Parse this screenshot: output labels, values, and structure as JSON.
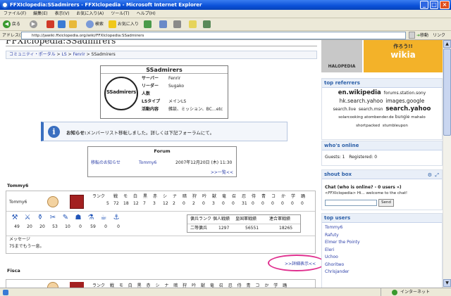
{
  "window": {
    "title": "FFXIclopedia:SSadmirers - FFXIclopedia - Microsoft Internet Explorer"
  },
  "menu": [
    "ファイル(F)",
    "編集(E)",
    "表示(V)",
    "お気に入り(A)",
    "ツール(T)",
    "ヘルプ(H)"
  ],
  "toolbar": {
    "back": "戻る",
    "search": "検索",
    "favorites": "お気に入り"
  },
  "address": {
    "label": "アドレス(D)",
    "url": "http://jawiki.ffxiclopedia.org/wiki/FFXIclopedia:SSadmirers",
    "go": "移動",
    "links": "リンク"
  },
  "page": {
    "title": "FFXIclopedia:SSadmirers",
    "breadcrumb": {
      "a": "コミュニティ・ポータル",
      "b": "LS",
      "c": "Fenrir",
      "d": "SSadmirers"
    },
    "infobox": {
      "name": "SSadmirers",
      "logo_text": "SSadmirers",
      "rows": [
        [
          "サーバー",
          "Fenrir"
        ],
        [
          "リーダー",
          "Sugako"
        ],
        [
          "人数",
          ""
        ],
        [
          "LSタイプ",
          "メインLS"
        ],
        [
          "活動内容",
          "雑談、ミッション、BC…etc"
        ]
      ]
    },
    "notice": {
      "label": "お知らせ:",
      "text": "メンバーリスト移転しました。詳しくは下記フォーラムにて。"
    },
    "forum": {
      "title": "Forum",
      "topic": "移転のお知らせ",
      "user": "Tommy6",
      "date": "2007年12月20日 (木) 11:30",
      "more": ">>一覧<<"
    },
    "member1": {
      "name": "Tommy6",
      "player": "Tommy6",
      "headers": [
        "ランク",
        "戦",
        "モ",
        "白",
        "黒",
        "赤",
        "シ",
        "ナ",
        "暗",
        "狩",
        "吟",
        "獣",
        "竜",
        "召",
        "忍",
        "侍",
        "青",
        "コ",
        "か",
        "学",
        "踊"
      ],
      "values": [
        "5",
        "72",
        "18",
        "12",
        "7",
        "3",
        "12",
        "2",
        "0",
        "2",
        "0",
        "3",
        "0",
        "0",
        "31",
        "0",
        "0",
        "0",
        "0",
        "0",
        "0"
      ],
      "crafts": [
        "49",
        "20",
        "20",
        "53",
        "10",
        "0",
        "59",
        "0",
        "0"
      ],
      "ranks": {
        "h1": "傭兵ランク",
        "h2": "個人戦績",
        "h3": "皇国軍戦績",
        "h4": "連合軍戦績",
        "v1": "二等傭兵",
        "v2": "1297",
        "v3": "56551",
        "v4": "18265"
      },
      "msg_label": "メッセージ",
      "msg": "75までもう一息。",
      "detail": ">>詳細表示<<"
    },
    "member2": {
      "name": "Fisca",
      "headers": "ランク 戦 モ 白 黒 赤 シ ナ 暗 狩 吟 獣 竜 召 忍 侍 青 コ か 学 踊"
    }
  },
  "sidebar": {
    "banner": {
      "a": "HALOPEDIA",
      "b": "作ろう!!",
      "c": "wikia"
    },
    "referrers": {
      "title": "top referrers",
      "items": [
        "en.wikipedia",
        "forums.station.sony",
        "hk.search.yahoo",
        "images.google",
        "search.live",
        "search.msn",
        "search.yahoo",
        "solarcooking",
        "atombender.de",
        "bungie",
        "mahalo",
        "shortpacked",
        "stumbleupon"
      ]
    },
    "whos_online": {
      "title": "who's online",
      "text": "Guests: 1   Registered: 0"
    },
    "shoutbox": {
      "title": "shout box",
      "chat": "Chat (who is online? - 0 users »)",
      "line": "<FFXIclopedia> Hi... welcome to the chat!",
      "send": "Send"
    },
    "top_users": {
      "title": "top users",
      "items": [
        "Tommy6",
        "Rafuty",
        "Elmer the Pointy",
        "Eleri",
        "Uchoo",
        "Ghoritwo",
        "Chrisjander"
      ]
    }
  },
  "status": {
    "zone": "インターネット"
  },
  "colors": {
    "accent": "#2c5fa8",
    "highlight": "#e0308f"
  }
}
